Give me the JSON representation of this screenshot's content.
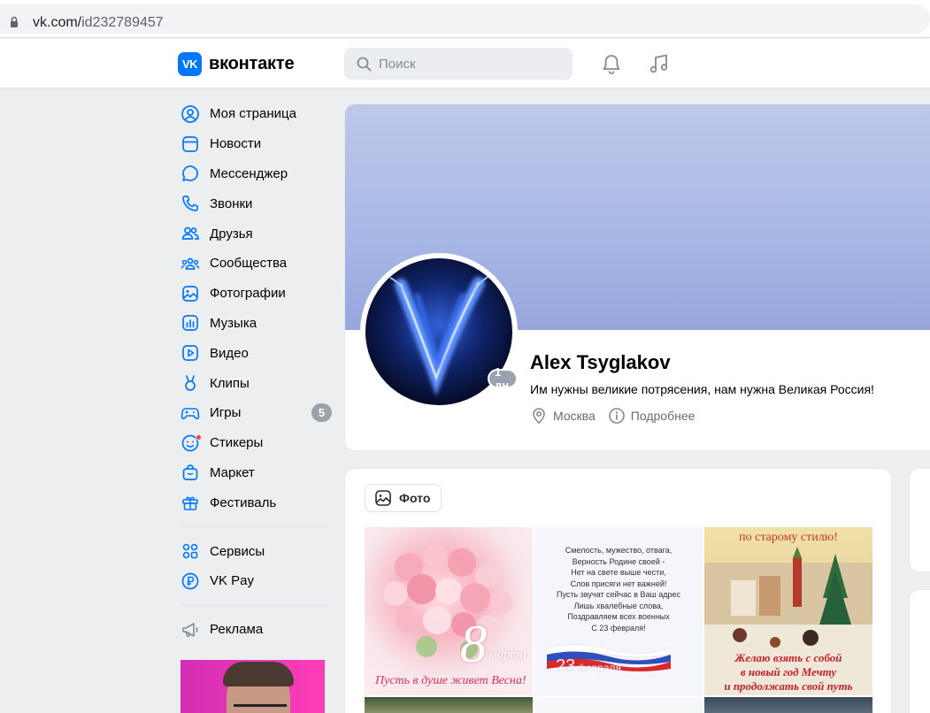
{
  "browser": {
    "url_host": "vk.com/",
    "url_path": "id232789457"
  },
  "header": {
    "logo_mark": "VK",
    "logo_text": "вконтакте",
    "search_placeholder": "Поиск",
    "bell_icon": "bell-icon",
    "music_icon": "music-note-icon"
  },
  "sidebar": {
    "items": [
      {
        "label": "Моя страница",
        "icon": "user-circle-icon"
      },
      {
        "label": "Новости",
        "icon": "news-feed-icon"
      },
      {
        "label": "Мессенджер",
        "icon": "chat-bubble-icon"
      },
      {
        "label": "Звонки",
        "icon": "phone-icon"
      },
      {
        "label": "Друзья",
        "icon": "friends-icon"
      },
      {
        "label": "Сообщества",
        "icon": "communities-icon"
      },
      {
        "label": "Фотографии",
        "icon": "photo-icon"
      },
      {
        "label": "Музыка",
        "icon": "music-icon"
      },
      {
        "label": "Видео",
        "icon": "video-icon"
      },
      {
        "label": "Клипы",
        "icon": "clips-icon"
      },
      {
        "label": "Игры",
        "icon": "gamepad-icon",
        "badge": "5"
      },
      {
        "label": "Стикеры",
        "icon": "sticker-icon"
      },
      {
        "label": "Маркет",
        "icon": "market-bag-icon"
      },
      {
        "label": "Фестиваль",
        "icon": "gift-icon"
      }
    ],
    "secondary": [
      {
        "label": "Сервисы",
        "icon": "services-grid-icon"
      },
      {
        "label": "VK Pay",
        "icon": "vk-pay-icon"
      }
    ],
    "tertiary": [
      {
        "label": "Реклама",
        "icon": "megaphone-icon"
      }
    ]
  },
  "profile": {
    "name": "Alex Tsyglakov",
    "status": "Им нужны великие потрясения, нам нужна Великая Россия!",
    "last_seen": "1 дн",
    "city": "Москва",
    "more_label": "Подробнее"
  },
  "photos": {
    "tab_label": "Фото",
    "tile1_caption_big": "8",
    "tile1_caption_small": "марта",
    "tile1_caption": "Пусть в душе живет Весна!",
    "tile2_poem": [
      "Смелость, мужество, отвага,",
      "Верность Родине своей -",
      "Нет на свете выше чести,",
      "Слов присяги нет важней!",
      "Пусть звучат сейчас в Ваш адрес",
      "Лишь хвалебные слова,",
      "Поздравляем всех военных",
      "С 23 февраля!"
    ],
    "tile2_date": "23",
    "tile2_month": "февраля",
    "tile3_top": "по старому стилю!",
    "tile3_line1": "Желаю взять с собой",
    "tile3_line2": "в новый год Мечту",
    "tile3_line3": "и продолжать свой путь"
  },
  "colors": {
    "accent": "#0077ff",
    "badge": "#99a2ad",
    "cover": "#a9b9e6",
    "notification_dot": "#e64646"
  }
}
